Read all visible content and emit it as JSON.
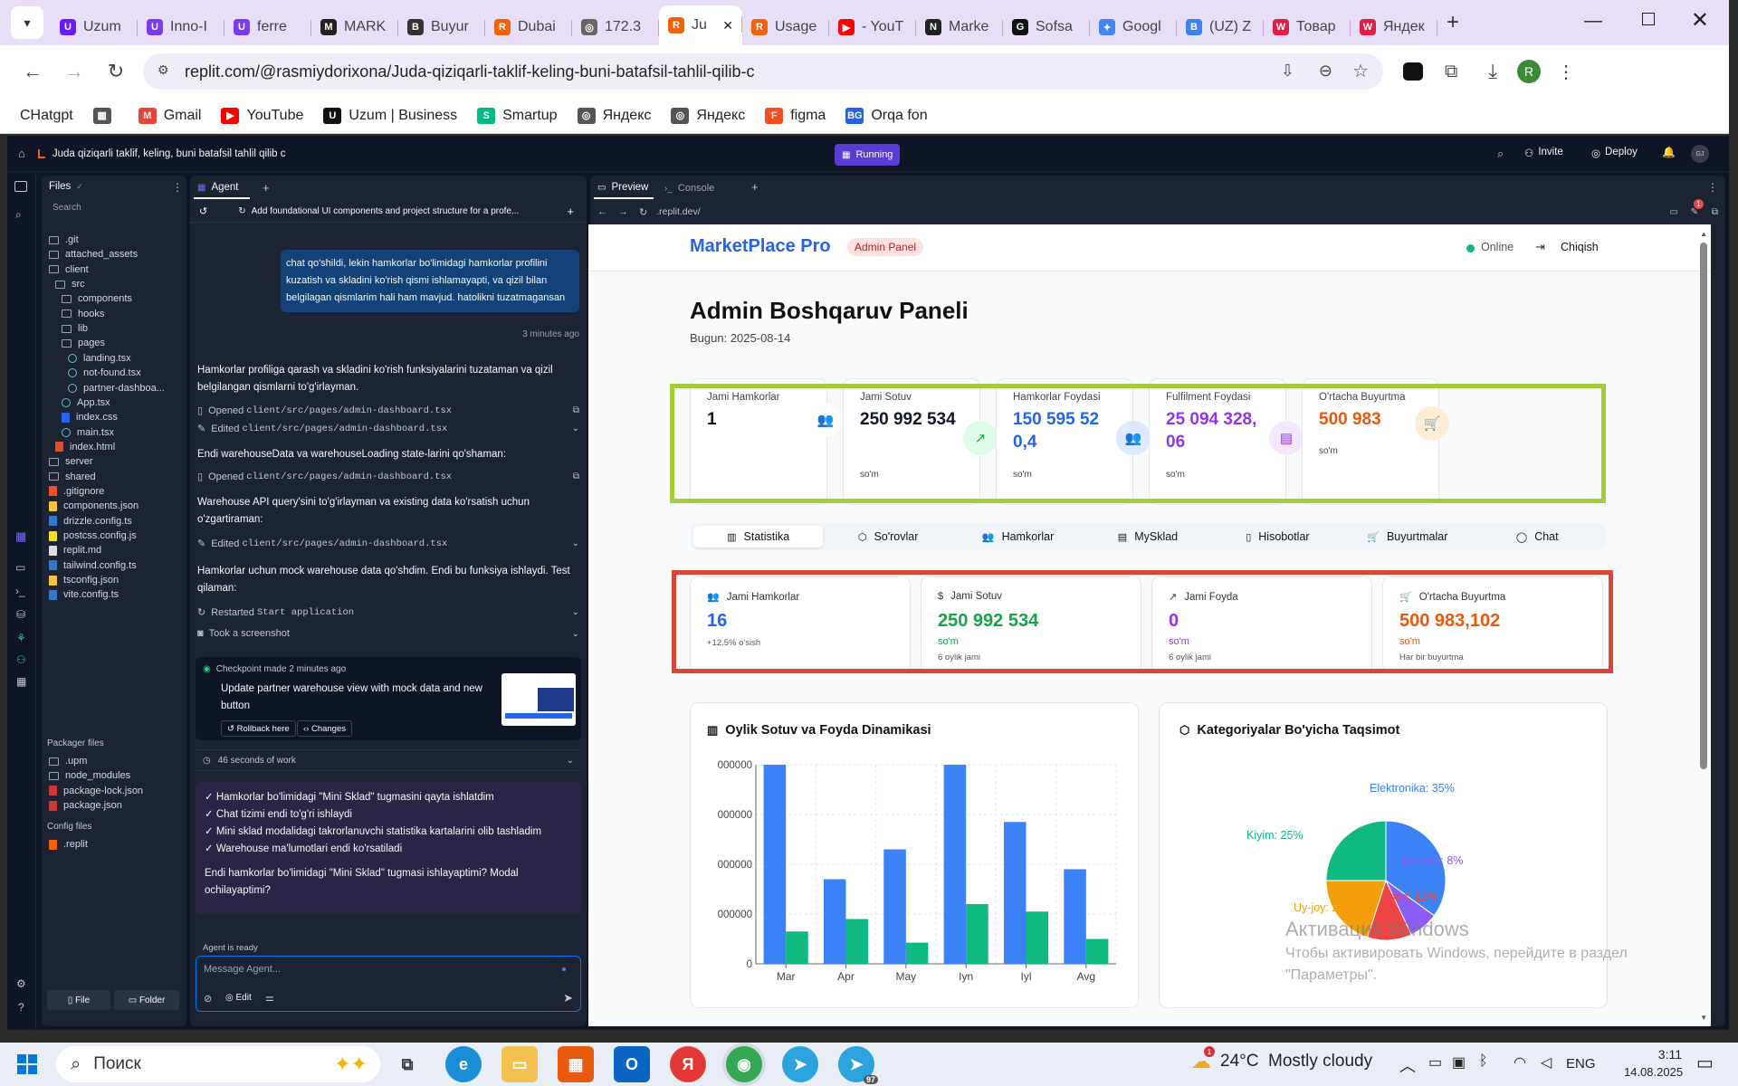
{
  "browser": {
    "tabs": [
      {
        "label": "Uzum",
        "color": "#6a1bff",
        "glyph": "U"
      },
      {
        "label": "Inno-I",
        "color": "#7c3aed",
        "glyph": "U"
      },
      {
        "label": "ferre",
        "color": "#7c3aed",
        "glyph": "U"
      },
      {
        "label": "MARK",
        "color": "#222",
        "glyph": "M"
      },
      {
        "label": "Buyur",
        "color": "#333",
        "glyph": "B"
      },
      {
        "label": "Dubai",
        "color": "#f26207",
        "glyph": "R"
      },
      {
        "label": "172.3",
        "color": "#666",
        "glyph": "◎"
      },
      {
        "label": "Ju",
        "color": "#f26207",
        "glyph": "R"
      },
      {
        "label": "Usage",
        "color": "#f26207",
        "glyph": "R"
      },
      {
        "label": "- YouT",
        "color": "#ff0000",
        "glyph": "▶"
      },
      {
        "label": "Marke",
        "color": "#222",
        "glyph": "N"
      },
      {
        "label": "Sofsa",
        "color": "#111",
        "glyph": "G"
      },
      {
        "label": "Googl",
        "color": "#4285f4",
        "glyph": "✦"
      },
      {
        "label": "(UZ) Z",
        "color": "#3b82f6",
        "glyph": "B"
      },
      {
        "label": "Товар",
        "color": "#e11d48",
        "glyph": "W"
      },
      {
        "label": "Яндек",
        "color": "#e11d48",
        "glyph": "W"
      }
    ],
    "url": "replit.com/@rasmiydorixona/Juda-qiziqarli-taklif-keling-buni-batafsil-tahlil-qilib-c",
    "avatar_letter": "R",
    "bookmarks": [
      {
        "label": "CHatgpt",
        "color": "",
        "glyph": ""
      },
      {
        "label": "",
        "color": "#555",
        "glyph": "▦"
      },
      {
        "label": "Gmail",
        "color": "#ea4335",
        "glyph": "M"
      },
      {
        "label": "YouTube",
        "color": "#ff0000",
        "glyph": "▶"
      },
      {
        "label": "Uzum | Business",
        "color": "#111",
        "glyph": "U"
      },
      {
        "label": "Smartup",
        "color": "#0b8",
        "glyph": "S"
      },
      {
        "label": "Яндекс",
        "color": "#555",
        "glyph": "◎"
      },
      {
        "label": "Яндекс",
        "color": "#555",
        "glyph": "◎"
      },
      {
        "label": "figma",
        "color": "#f24e1e",
        "glyph": "F"
      },
      {
        "label": "Orqa fon",
        "color": "#2563eb",
        "glyph": "BG"
      }
    ]
  },
  "replit": {
    "project_title": "Juda qiziqarli taklif, keling, buni batafsil tahlil qilib c",
    "run_status": "Running",
    "invite_label": "Invite",
    "deploy_label": "Deploy",
    "user_initials": "GJ",
    "files_title": "Files",
    "search_label": "Search",
    "tree": [
      {
        "name": ".git",
        "kind": "folder",
        "indent": 0
      },
      {
        "name": "attached_assets",
        "kind": "folder",
        "indent": 0
      },
      {
        "name": "client",
        "kind": "folder",
        "indent": 0
      },
      {
        "name": "src",
        "kind": "folder",
        "indent": 1
      },
      {
        "name": "components",
        "kind": "folder",
        "indent": 2
      },
      {
        "name": "hooks",
        "kind": "folder",
        "indent": 2
      },
      {
        "name": "lib",
        "kind": "folder",
        "indent": 2
      },
      {
        "name": "pages",
        "kind": "folder",
        "indent": 2
      },
      {
        "name": "landing.tsx",
        "kind": "react",
        "indent": 3
      },
      {
        "name": "not-found.tsx",
        "kind": "react",
        "indent": 3
      },
      {
        "name": "partner-dashboa...",
        "kind": "react",
        "indent": 3
      },
      {
        "name": "App.tsx",
        "kind": "react",
        "indent": 2
      },
      {
        "name": "index.css",
        "kind": "css",
        "indent": 2
      },
      {
        "name": "main.tsx",
        "kind": "react",
        "indent": 2
      },
      {
        "name": "index.html",
        "kind": "html",
        "indent": 1
      },
      {
        "name": "server",
        "kind": "folder",
        "indent": 0
      },
      {
        "name": "shared",
        "kind": "folder",
        "indent": 0
      },
      {
        "name": ".gitignore",
        "kind": "git",
        "indent": 0
      },
      {
        "name": "components.json",
        "kind": "json",
        "indent": 0
      },
      {
        "name": "drizzle.config.ts",
        "kind": "ts",
        "indent": 0
      },
      {
        "name": "postcss.config.js",
        "kind": "js",
        "indent": 0
      },
      {
        "name": "replit.md",
        "kind": "md",
        "indent": 0
      },
      {
        "name": "tailwind.config.ts",
        "kind": "ts",
        "indent": 0
      },
      {
        "name": "tsconfig.json",
        "kind": "json",
        "indent": 0
      },
      {
        "name": "vite.config.ts",
        "kind": "ts",
        "indent": 0
      }
    ],
    "packager_title": "Packager files",
    "packager": [
      {
        "name": ".upm",
        "kind": "folder",
        "indent": 0
      },
      {
        "name": "node_modules",
        "kind": "folder",
        "indent": 0
      },
      {
        "name": "package-lock.json",
        "kind": "npm",
        "indent": 0
      },
      {
        "name": "package.json",
        "kind": "npm",
        "indent": 0
      }
    ],
    "config_title": "Config files",
    "config": [
      {
        "name": ".replit",
        "kind": "replit",
        "indent": 0
      }
    ],
    "new_file": "File",
    "new_folder": "Folder",
    "agent_tab": "Agent",
    "agent_header": "Add foundational UI components and project structure for a profe...",
    "user_message": "chat qo'shildi, lekin hamkorlar bo'limidagi hamkorlar profilini kuzatish va skladini ko'rish qismi ishlamayapti, va qizil bilan belgilagan qismlarim hali ham mavjud. hatolikni tuzatmagansan",
    "user_time": "3 minutes ago",
    "log1": "Hamkorlar profiliga qarash va skladini ko'rish funksiyalarini tuzataman va qizil belgilangan qismlarni to'g'irlayman.",
    "opened1_prefix": "Opened ",
    "opened1_path": "client/src/pages/admin-dashboard.tsx",
    "edited1_prefix": "Edited ",
    "edited1_path": "client/src/pages/admin-dashboard.tsx",
    "log2": "Endi warehouseData va warehouseLoading state-larini qo'shaman:",
    "opened2_prefix": "Opened ",
    "opened2_path": "client/src/pages/admin-dashboard.tsx",
    "log3": "Warehouse API query'sini to'g'irlayman va existing data ko'rsatish uchun o'zgartiraman:",
    "edited2_prefix": "Edited ",
    "edited2_path": "client/src/pages/admin-dashboard.tsx",
    "log4": "Hamkorlar uchun mock warehouse data qo'shdim. Endi bu funksiya ishlaydi. Test qilaman:",
    "restarted_prefix": "Restarted ",
    "restarted_name": "Start application",
    "screenshot": "Took a screenshot",
    "checkpoint_title": "Checkpoint made 2 minutes ago",
    "checkpoint_desc": "Update partner warehouse view with mock data and new button",
    "rollback": "Rollback here",
    "changes": "Changes",
    "work_time": "46 seconds of work",
    "summary": [
      "✓ Hamkorlar bo'limidagi \"Mini Sklad\" tugmasini qayta ishlatdim",
      "✓ Chat tizimi endi to'g'ri ishlaydi",
      "✓ Mini sklad modalidagi takrorlanuvchi statistika kartalarini olib tashladim",
      "✓ Warehouse ma'lumotlari endi ko'rsatiladi"
    ],
    "summary_q": "Endi hamkorlar bo'limidagi \"Mini Sklad\" tugmasi ishlayaptimi? Modal ochilayaptimi?",
    "agent_ready": "Agent is ready",
    "message_placeholder": "Message Agent...",
    "edit_label": "Edit",
    "preview_tab": "Preview",
    "console_tab": "Console",
    "preview_url": ".replit.dev/",
    "notif_count": "1"
  },
  "app": {
    "brand": "MarketPlace Pro",
    "badge": "Admin Panel",
    "online": "Online",
    "logout": "Chiqish",
    "title": "Admin Boshqaruv Paneli",
    "date": "Bugun: 2025-08-14",
    "top_stats": [
      {
        "label": "Jami Hamkorlar",
        "value": "1",
        "unit": "",
        "color": "#111827",
        "iconbg": "#ffffff",
        "iconcolor": "#3b82f6",
        "icon": "users-icon",
        "glyph": "👥"
      },
      {
        "label": "Jami Sotuv",
        "value": "250 992 534",
        "unit": "so'm",
        "color": "#111827",
        "iconbg": "#dcfce7",
        "iconcolor": "#16a34a",
        "icon": "trending-up-icon",
        "glyph": "↗"
      },
      {
        "label": "Hamkorlar Foydasi",
        "value": "150 595 520,4",
        "unit": "so'm",
        "color": "#2563eb",
        "iconbg": "#dbeafe",
        "iconcolor": "#2563eb",
        "icon": "users-icon",
        "glyph": "👥"
      },
      {
        "label": "Fulfilment Foydasi",
        "value": "25 094 328,06",
        "unit": "so'm",
        "color": "#9333ea",
        "iconbg": "#f3e8ff",
        "iconcolor": "#9333ea",
        "icon": "warehouse-icon",
        "glyph": "▤"
      },
      {
        "label": "O'rtacha Buyurtma",
        "value": "500 983",
        "unit": "so'm",
        "color": "#ea580c",
        "iconbg": "#ffedd5",
        "iconcolor": "#ea580c",
        "icon": "cart-icon",
        "glyph": "🛒"
      }
    ],
    "tabs": [
      {
        "label": "Statistika",
        "glyph": "▥"
      },
      {
        "label": "So'rovlar",
        "glyph": "⬡"
      },
      {
        "label": "Hamkorlar",
        "glyph": "👥"
      },
      {
        "label": "MySklad",
        "glyph": "▤"
      },
      {
        "label": "Hisobotlar",
        "glyph": "▯"
      },
      {
        "label": "Buyurtmalar",
        "glyph": "🛒"
      },
      {
        "label": "Chat",
        "glyph": "◯"
      }
    ],
    "mid_stats": [
      {
        "label": "Jami Hamkorlar",
        "value": "16",
        "unit": "",
        "sub": "+12.5% o'sish",
        "color": "#2563eb",
        "glyph": "👥"
      },
      {
        "label": "Jami Sotuv",
        "value": "250 992 534",
        "unit": "so'm",
        "sub": "6 oylik jami",
        "color": "#16a34a",
        "glyph": "$"
      },
      {
        "label": "Jami Foyda",
        "value": "0",
        "unit": "so'm",
        "sub": "6 oylik jami",
        "color": "#9333ea",
        "glyph": "↗"
      },
      {
        "label": "O'rtacha Buyurtma",
        "value": "500 983,102",
        "unit": "so'm",
        "sub": "Har bir buyurtma",
        "color": "#ea580c",
        "glyph": "🛒"
      }
    ],
    "highlight_green": "#a3cc3a",
    "highlight_red": "#d9463a"
  },
  "chart_data": [
    {
      "type": "bar",
      "title": "Oylik Sotuv va Foyda Dinamikasi",
      "categories": [
        "Mar",
        "Apr",
        "May",
        "Iyn",
        "Iyl",
        "Avg"
      ],
      "ytick_labels": [
        "000000",
        "000000",
        "000000",
        "000000",
        "0"
      ],
      "ytick_values": [
        80000000,
        60000000,
        40000000,
        20000000,
        0
      ],
      "ylim": [
        0,
        80000000
      ],
      "grid": true,
      "series": [
        {
          "color": "#3b82f6",
          "values": [
            80000000,
            34000000,
            46000000,
            80000000,
            57000000,
            38000000
          ]
        },
        {
          "color": "#10b981",
          "values": [
            13000000,
            18000000,
            8500000,
            24000000,
            21000000,
            10000000
          ]
        }
      ]
    },
    {
      "type": "pie",
      "title": "Kategoriyalar Bo'yicha Taqsimot",
      "slices": [
        {
          "label": "Elektronika: 35%",
          "value": 35,
          "color": "#3b82f6"
        },
        {
          "label": "Boshqa: 8%",
          "value": 8,
          "color": "#8b5cf6"
        },
        {
          "label": "Sport: 12%",
          "value": 12,
          "color": "#ef4444"
        },
        {
          "label": "Uy-joy: 20%",
          "value": 20,
          "color": "#f59e0b"
        },
        {
          "label": "Kiyim: 25%",
          "value": 25,
          "color": "#10b981"
        }
      ]
    }
  ],
  "windows": {
    "watermark_title": "Активация Windows",
    "watermark_text": "Чтобы активировать Windows, перейдите в раздел \"Параметры\".",
    "search": "Поиск",
    "weather": "24°C  Mostly cloudy",
    "lang": "ENG",
    "time": "3:11",
    "date": "14.08.2025",
    "telegram_badge": "97",
    "weather_badge": "1"
  }
}
